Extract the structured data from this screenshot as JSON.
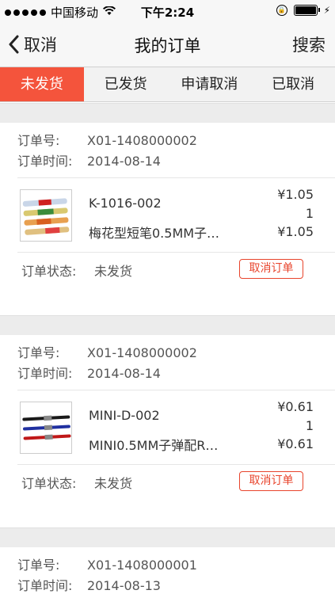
{
  "status_bar": {
    "carrier": "中国移动",
    "time": "下午2:24"
  },
  "nav": {
    "back_label": "取消",
    "title": "我的订单",
    "search_label": "搜索"
  },
  "tabs": [
    {
      "label": "未发货",
      "active": true
    },
    {
      "label": "已发货",
      "active": false
    },
    {
      "label": "申请取消",
      "active": false
    },
    {
      "label": "已取消",
      "active": false
    }
  ],
  "labels": {
    "order_no": "订单号:",
    "order_time": "订单时间:",
    "order_status": "订单状态:",
    "cancel_button": "取消订单"
  },
  "orders": [
    {
      "order_no": "X01-1408000002",
      "order_time": "2014-08-14",
      "item": {
        "code": "K-1016-002",
        "name": "梅花型短笔0.5MM子…",
        "price": "¥1.05",
        "qty": "1",
        "total": "¥1.05"
      },
      "status": "未发货"
    },
    {
      "order_no": "X01-1408000002",
      "order_time": "2014-08-14",
      "item": {
        "code": "MINI-D-002",
        "name": "MINI0.5MM子弹配R…",
        "price": "¥0.61",
        "qty": "1",
        "total": "¥0.61"
      },
      "status": "未发货"
    },
    {
      "order_no": "X01-1408000001",
      "order_time": "2014-08-13"
    }
  ],
  "colors": {
    "accent": "#f4543c",
    "cancel": "#e8442c"
  }
}
